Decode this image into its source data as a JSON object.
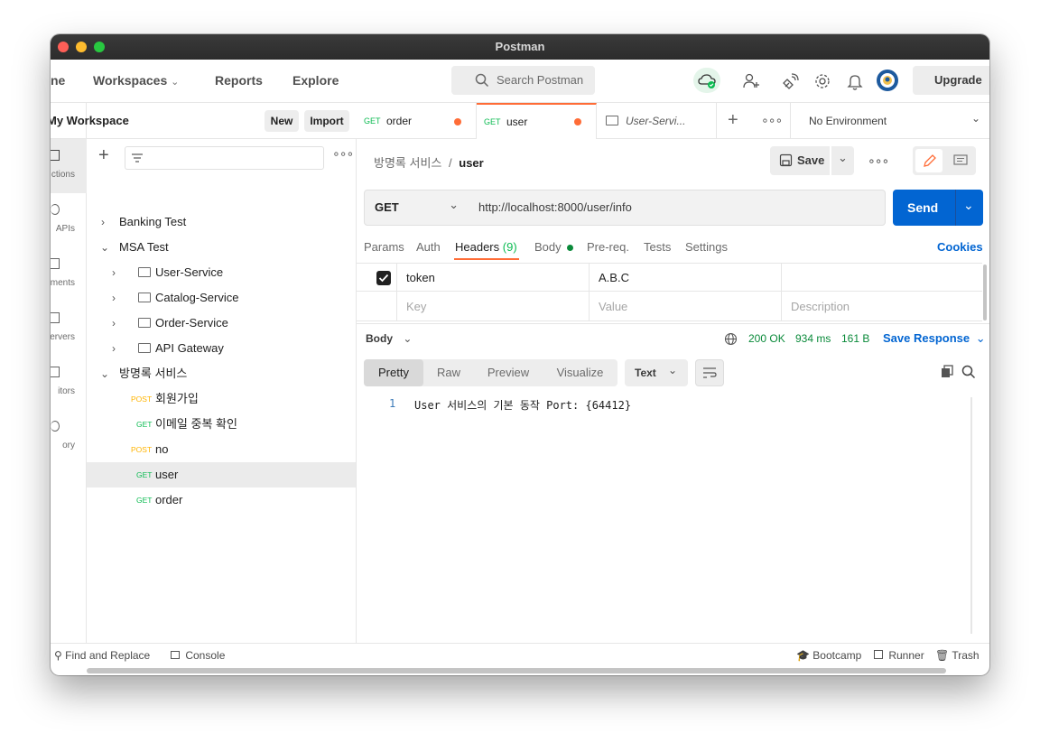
{
  "window": {
    "title": "Postman"
  },
  "header": {
    "home": "ne",
    "workspaces": "Workspaces",
    "reports": "Reports",
    "explore": "Explore",
    "search_placeholder": "Search Postman",
    "upgrade": "Upgrade"
  },
  "rail": {
    "items": [
      "ctions",
      "APIs",
      "ments",
      "ervers",
      "itors",
      "ory"
    ]
  },
  "workspace": {
    "title": "My Workspace",
    "new_label": "New",
    "import_label": "Import"
  },
  "tree": {
    "banking": "Banking Test",
    "msa": "MSA Test",
    "user_service": "User-Service",
    "catalog_service": "Catalog-Service",
    "order_service": "Order-Service",
    "api_gateway": "API Gateway",
    "guestbook": "방명록 서비스",
    "req1": {
      "method": "POST",
      "name": "회원가입"
    },
    "req2": {
      "method": "GET",
      "name": "이메일 중복 확인"
    },
    "req3": {
      "method": "POST",
      "name": "no"
    },
    "req4": {
      "method": "GET",
      "name": "user"
    },
    "req5": {
      "method": "GET",
      "name": "order"
    }
  },
  "tabs": {
    "t1": {
      "method": "GET",
      "name": "order"
    },
    "t2": {
      "method": "GET",
      "name": "user"
    },
    "t3": {
      "name": "User-Servi..."
    },
    "environment": "No Environment"
  },
  "breadcrumb": {
    "parent": "방명록 서비스",
    "sep": "/",
    "current": "user"
  },
  "toolbar": {
    "save": "Save"
  },
  "request": {
    "method": "GET",
    "url": "http://localhost:8000/user/info",
    "send": "Send"
  },
  "req_tabs": {
    "params": "Params",
    "auth": "Auth",
    "headers": "Headers",
    "headers_count": "(9)",
    "body": "Body",
    "prereq": "Pre-req.",
    "tests": "Tests",
    "settings": "Settings",
    "cookies": "Cookies"
  },
  "headers_table": {
    "row1": {
      "key": "token",
      "value": "A.B.C"
    },
    "placeholder_key": "Key",
    "placeholder_value": "Value",
    "placeholder_desc": "Description"
  },
  "response": {
    "body_label": "Body",
    "status": "200 OK",
    "time": "934 ms",
    "size": "161 B",
    "save_response": "Save Response",
    "formats": [
      "Pretty",
      "Raw",
      "Preview",
      "Visualize"
    ],
    "type": "Text",
    "line_no": "1",
    "line_text": "User 서비스의 기본 동작 Port: {64412}"
  },
  "footer": {
    "find_replace": "Find and Replace",
    "console": "Console",
    "bootcamp": "Bootcamp",
    "runner": "Runner",
    "trash": "Trash"
  },
  "colors": {
    "accent": "#ff6c37",
    "send": "#0265d2",
    "status_ok": "#0a8a3a",
    "get": "#0cbb52",
    "post": "#ffb400"
  }
}
